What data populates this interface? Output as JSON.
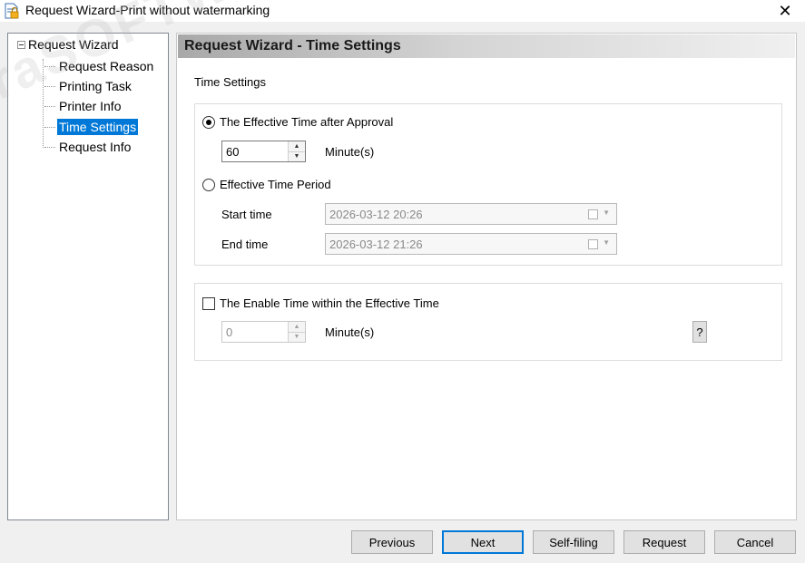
{
  "window": {
    "title": "Request Wizard-Print without watermarking",
    "close_glyph": "✕",
    "icon": "document-lock-icon"
  },
  "watermark": {
    "text": "iraSOFTWARE"
  },
  "tree": {
    "root": {
      "label": "Request Wizard",
      "expanded": true
    },
    "items": [
      {
        "label": "Request Reason",
        "selected": false
      },
      {
        "label": "Printing Task",
        "selected": false
      },
      {
        "label": "Printer Info",
        "selected": false
      },
      {
        "label": "Time Settings",
        "selected": true
      },
      {
        "label": "Request Info",
        "selected": false
      }
    ]
  },
  "content": {
    "header": "Request Wizard - Time Settings",
    "section_label": "Time Settings",
    "effective_after_approval": {
      "label": "The Effective Time after Approval",
      "checked": true,
      "value": "60",
      "unit": "Minute(s)"
    },
    "effective_period": {
      "label": "Effective Time Period",
      "checked": false,
      "start_label": "Start time",
      "start_value": "2026-03-12 20:26",
      "end_label": "End time",
      "end_value": "2026-03-12 21:26"
    },
    "enable_time": {
      "label": "The Enable Time within the Effective Time",
      "checked": false,
      "value": "0",
      "unit": "Minute(s)",
      "help": "?"
    }
  },
  "buttons": {
    "previous": "Previous",
    "next": "Next",
    "self_filing": "Self-filing",
    "request": "Request",
    "cancel": "Cancel"
  },
  "colors": {
    "selection": "#0078d7",
    "default_button_border": "#0078d7"
  }
}
